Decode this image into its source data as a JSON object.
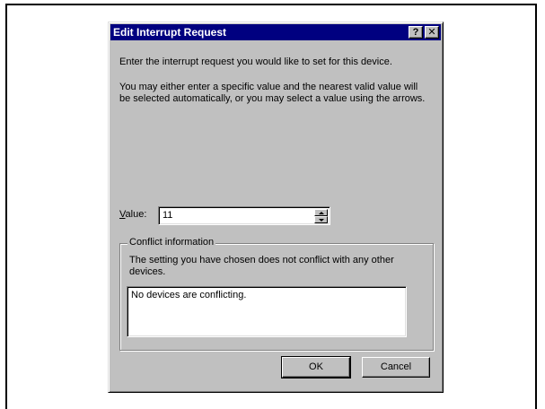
{
  "dialog": {
    "title": "Edit Interrupt Request",
    "help_glyph": "?",
    "close_glyph": "✕",
    "instruction": "Enter the interrupt request you would like to set for this device.",
    "explanation": "You may either enter a specific value and the nearest valid value will be selected automatically, or you may select a value using the arrows.",
    "value_label_first": "V",
    "value_label_rest": "alue:",
    "value": "11",
    "conflict": {
      "title": "Conflict information",
      "message": "The setting you have chosen does not conflict with any other devices.",
      "list_text": "No devices are conflicting."
    },
    "buttons": {
      "ok": "OK",
      "cancel": "Cancel"
    }
  },
  "icons": [
    "help-icon",
    "close-icon",
    "spin-up-arrow-icon",
    "spin-down-arrow-icon"
  ],
  "colors": {
    "titlebar": "#000080",
    "face": "#c0c0c0",
    "window": "#ffffff"
  }
}
